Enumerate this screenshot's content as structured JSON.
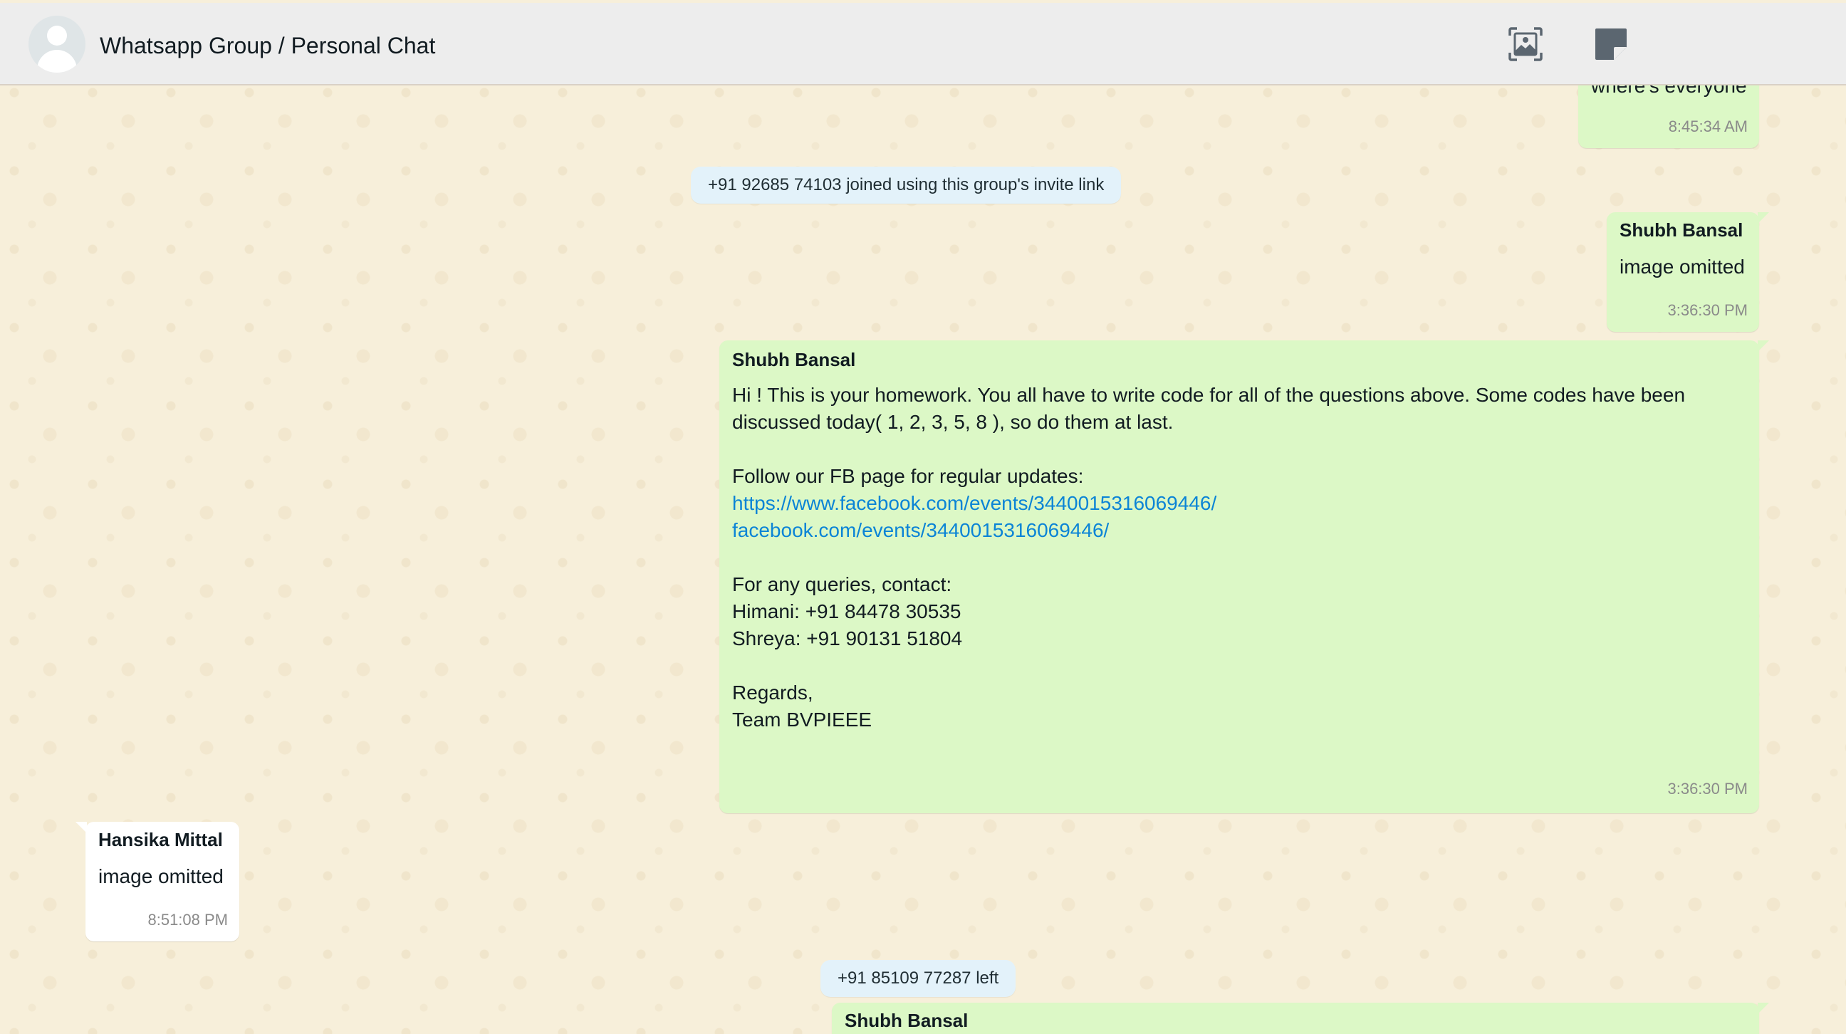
{
  "header": {
    "title": "Whatsapp Group / Personal Chat",
    "icons": [
      "image-export-icon",
      "sticky-note-icon"
    ]
  },
  "messages": [
    {
      "type": "outgoing",
      "text": "where's everyone",
      "time": "8:45:34 AM"
    },
    {
      "type": "system",
      "text": "+91 92685 74103 joined using this group's invite link"
    },
    {
      "type": "outgoing",
      "sender": "Shubh Bansal",
      "text": "image omitted",
      "time": "3:36:30 PM"
    },
    {
      "type": "outgoing",
      "sender": "Shubh Bansal",
      "text_line1": "Hi ! This is your homework. You all have to write code for all of the questions above. Some codes have been",
      "text_line2": "discussed today( 1, 2, 3, 5, 8 ), so do them at last.",
      "follow_label": "Follow our FB page for regular updates:",
      "link1": "https://www.facebook.com/events/3440015316069446/",
      "link2": "facebook.com/events/3440015316069446/",
      "queries_label": "For any queries, contact:",
      "contact1": "Himani: +91 84478 30535",
      "contact2": "Shreya: +91 90131 51804",
      "regards": "Regards,",
      "team": "Team BVPIEEE",
      "time": "3:36:30 PM"
    },
    {
      "type": "incoming",
      "sender": "Hansika Mittal",
      "text": "image omitted",
      "time": "8:51:08 PM"
    },
    {
      "type": "system",
      "text": "+91 85109 77287 left"
    },
    {
      "type": "outgoing",
      "sender": "Shubh Bansal"
    }
  ],
  "colors": {
    "outgoing_bubble": "#dcf8c6",
    "incoming_bubble": "#ffffff",
    "system_bubble": "#e3f2fa",
    "link": "#0b84d6",
    "header_bg": "#ededed"
  }
}
